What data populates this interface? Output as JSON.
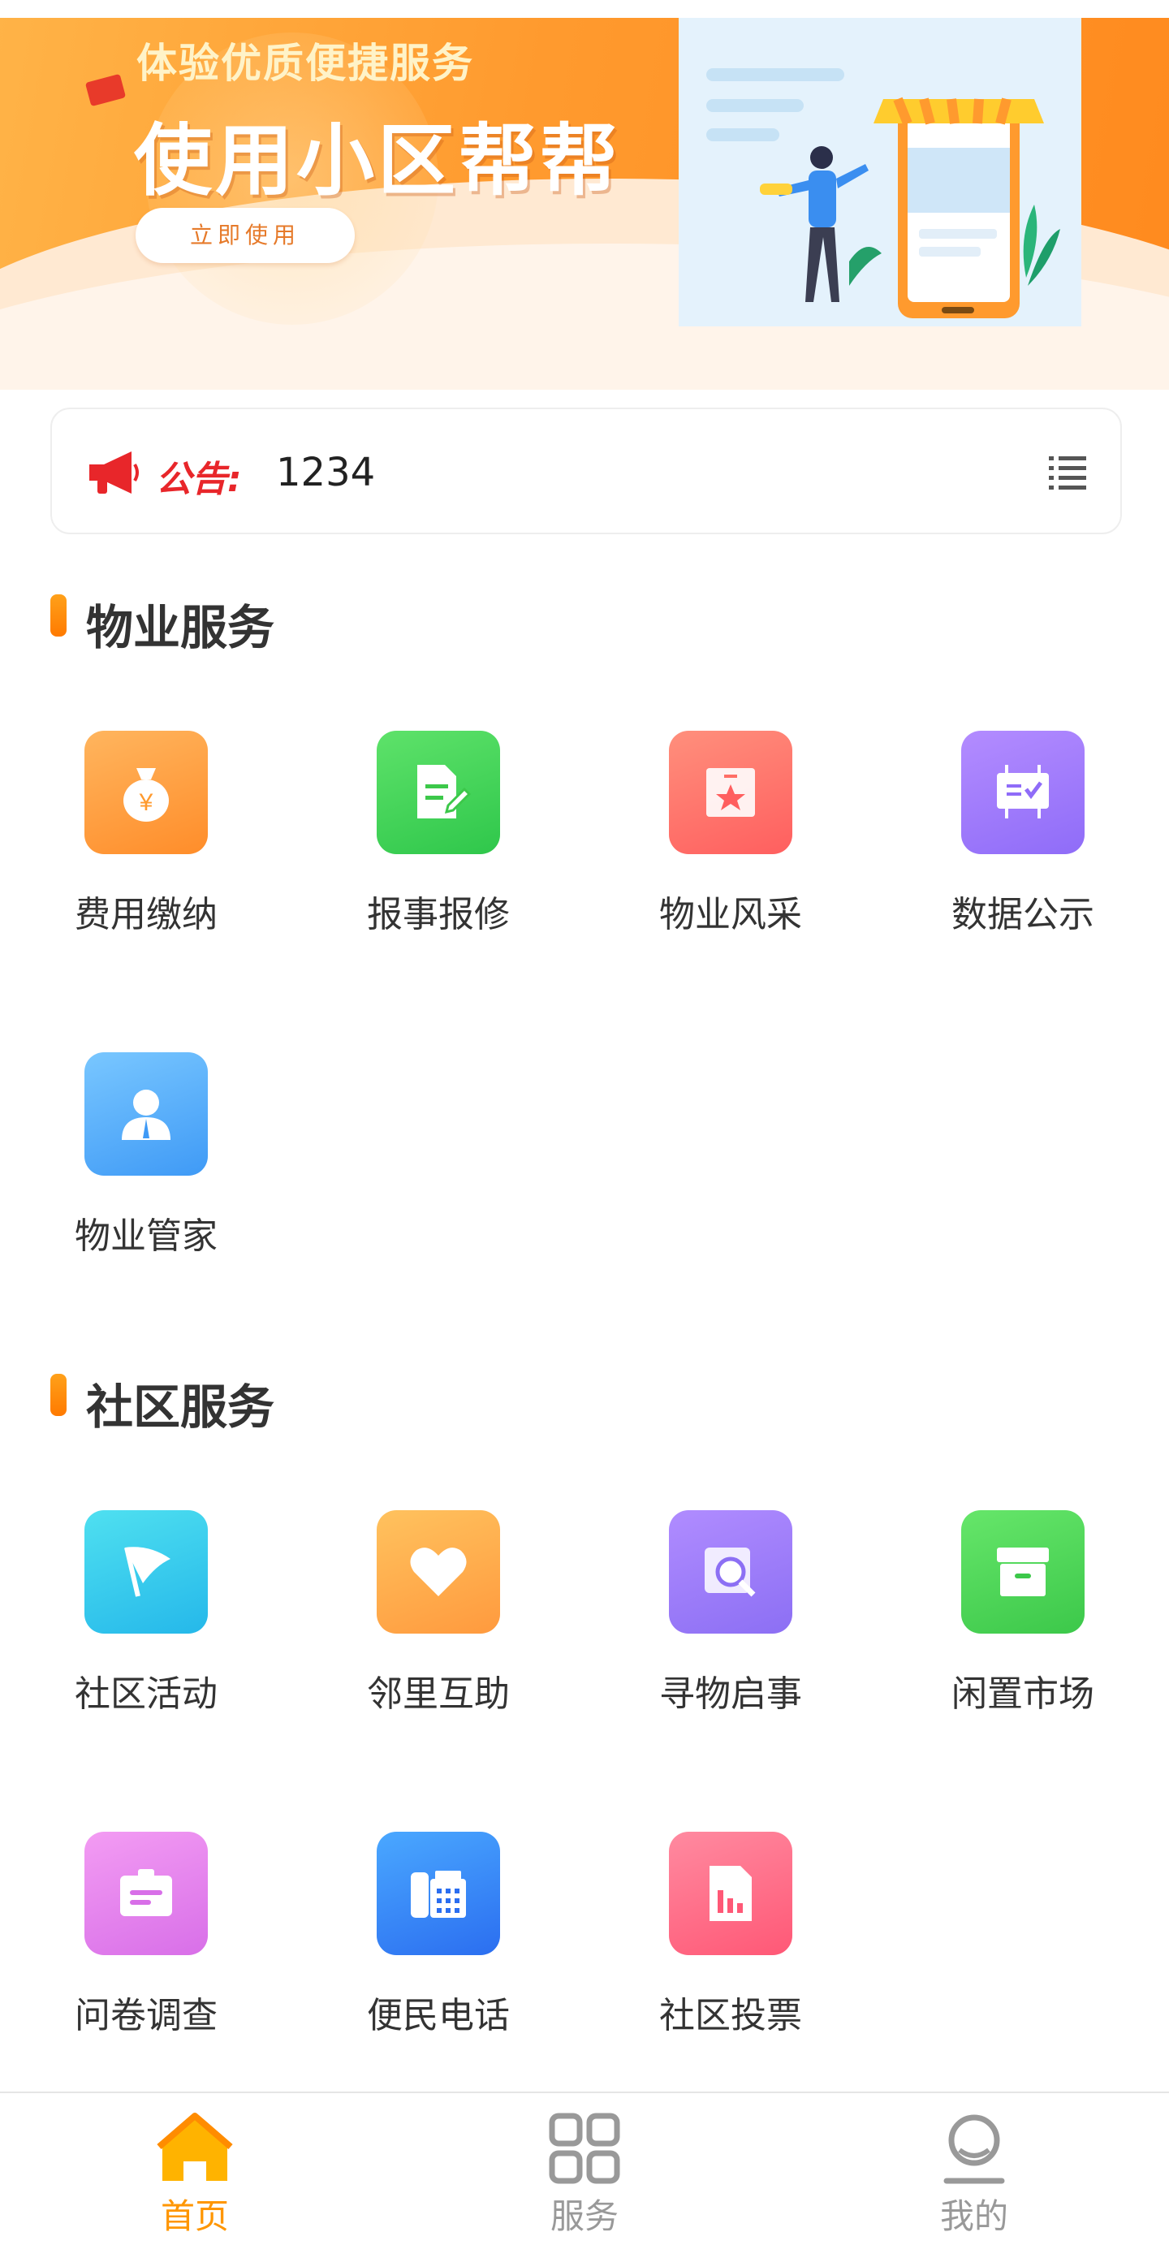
{
  "banner": {
    "subtitle": "体验优质便捷服务",
    "title": "使用小区帮帮",
    "cta_label": "立即使用"
  },
  "notice": {
    "label": "公告:",
    "text": "1234",
    "icons": [
      "megaphone-icon",
      "list-icon"
    ]
  },
  "sections": [
    {
      "title": "物业服务",
      "items": [
        {
          "label": "费用缴纳",
          "icon": "money-bag-icon",
          "color": "#ff9a3e"
        },
        {
          "label": "报事报修",
          "icon": "document-edit-icon",
          "color": "#3cc84a"
        },
        {
          "label": "物业风采",
          "icon": "star-card-icon",
          "color": "#ff6f66"
        },
        {
          "label": "数据公示",
          "icon": "board-check-icon",
          "color": "#9a78fa"
        },
        {
          "label": "物业管家",
          "icon": "person-icon",
          "color": "#4fa8fa"
        }
      ]
    },
    {
      "title": "社区服务",
      "items": [
        {
          "label": "社区活动",
          "icon": "flag-icon",
          "color": "#2ec6ec"
        },
        {
          "label": "邻里互助",
          "icon": "heart-icon",
          "color": "#ffa647"
        },
        {
          "label": "寻物启事",
          "icon": "search-card-icon",
          "color": "#9a7cf8"
        },
        {
          "label": "闲置市场",
          "icon": "box-icon",
          "color": "#43d252"
        },
        {
          "label": "问卷调查",
          "icon": "clipboard-icon",
          "color": "#e07ef0"
        },
        {
          "label": "便民电话",
          "icon": "phone-icon",
          "color": "#3a84f4"
        },
        {
          "label": "社区投票",
          "icon": "chart-doc-icon",
          "color": "#ff6a86"
        }
      ]
    }
  ],
  "tabbar": {
    "tabs": [
      {
        "label": "首页",
        "icon": "home-icon",
        "active": true
      },
      {
        "label": "服务",
        "icon": "grid-icon",
        "active": false
      },
      {
        "label": "我的",
        "icon": "profile-icon",
        "active": false
      }
    ],
    "active_color": "#ff9600",
    "inactive_color": "#999999"
  }
}
